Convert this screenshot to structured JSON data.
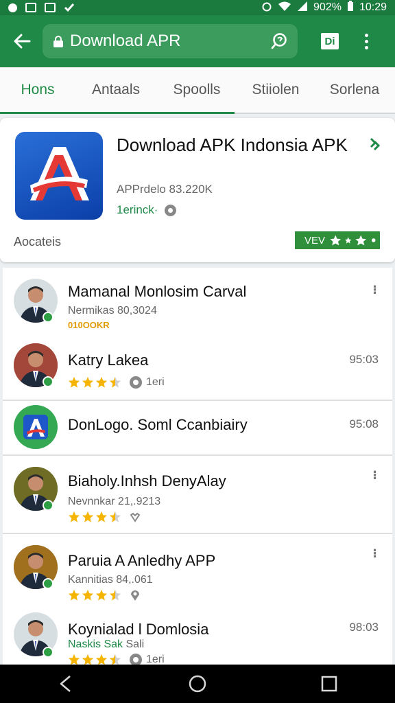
{
  "status_bar": {
    "battery": "902%",
    "time": "10:29"
  },
  "app_bar": {
    "url": "Download APR",
    "tabs_label": "Di"
  },
  "tabs": [
    {
      "label": "Hons",
      "active": true
    },
    {
      "label": "Antaals",
      "active": false
    },
    {
      "label": "Spoolls",
      "active": false
    },
    {
      "label": "Stiiolen",
      "active": false
    },
    {
      "label": "Sorlena",
      "active": false
    }
  ],
  "app_card": {
    "title": "Download APK Indonsia APK",
    "meta": "APPrdelo 83.220K",
    "installs": "1erinck·",
    "category": "Aocateis",
    "badge_text": "VEV"
  },
  "list": [
    {
      "title": "Mamanal Monlosim Carval",
      "sub": "Nermikas 80,3024",
      "tag": "010OOKR"
    },
    {
      "title": "Katry Lakea",
      "time": "95:03",
      "rating_text": "1eri"
    },
    {
      "title": "DonLogo. Soml Ccanbiairy",
      "time": "95:08"
    },
    {
      "title": "Biaholy.Inhsh DenyAlay",
      "sub": "Nevnnkar 21,.9213"
    },
    {
      "title": "Paruia A Anledhy APP",
      "sub": "Kannitias 84,.061"
    },
    {
      "title": "Koynialad l Domlosia",
      "time": "98:03",
      "green_text": "Naskis Sak",
      "sub_after": "Sali",
      "rating_text": "1eri"
    }
  ],
  "colors": {
    "primary": "#1f8a47",
    "status": "#1b7a3e",
    "star": "#f5b400"
  }
}
